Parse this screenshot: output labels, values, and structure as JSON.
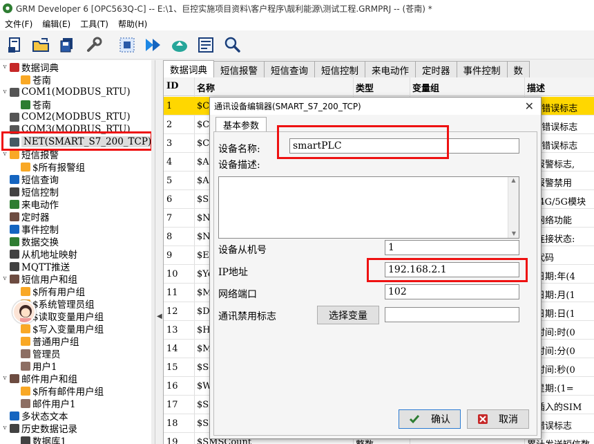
{
  "window": {
    "title": "GRM Developer 6 [OPC563Q-C]  -- E:\\1、巨控实施项目资料\\客户程序\\靓利能源\\测试工程.GRMPRJ -- (苍南) *"
  },
  "menu": [
    "文件(F)",
    "编辑(E)",
    "工具(T)",
    "帮助(H)"
  ],
  "toolbar": {
    "icons": [
      "new-file-icon",
      "open-folder-icon",
      "save-icon",
      "wrench-icon",
      "grid-icon",
      "forward-icon",
      "upload-icon",
      "settings-panel-icon",
      "magnifier-icon"
    ]
  },
  "tree": [
    {
      "label": "数据词典",
      "icon": "dictionary-icon",
      "indent": 1,
      "expander": "v",
      "color": "#c62828"
    },
    {
      "label": "苍南",
      "icon": "folder-icon",
      "indent": 2,
      "expander": "",
      "color": "#f9a825"
    },
    {
      "label": "COM1(MODBUS_RTU)",
      "icon": "serial-port-icon",
      "indent": 1,
      "expander": "v",
      "color": "#555"
    },
    {
      "label": "苍南",
      "icon": "device-icon",
      "indent": 2,
      "expander": "",
      "color": "#2e7d32"
    },
    {
      "label": "COM2(MODBUS_RTU)",
      "icon": "serial-port-icon",
      "indent": 1,
      "expander": "",
      "color": "#555"
    },
    {
      "label": "COM3(MODBUS_RTU)",
      "icon": "serial-port-icon",
      "indent": 1,
      "expander": "",
      "color": "#555"
    },
    {
      "label": "NET(SMART_S7_200_TCP)",
      "icon": "network-icon",
      "indent": 1,
      "expander": "",
      "color": "#455a64",
      "selected": true
    },
    {
      "label": "短信报警",
      "icon": "bell-icon",
      "indent": 1,
      "expander": "v",
      "color": "#f9a825"
    },
    {
      "label": "$所有报警组",
      "icon": "folder-icon",
      "indent": 2,
      "expander": "",
      "color": "#f9a825"
    },
    {
      "label": "短信查询",
      "icon": "sms-query-icon",
      "indent": 1,
      "expander": "",
      "color": "#1565c0"
    },
    {
      "label": "短信控制",
      "icon": "sms-control-icon",
      "indent": 1,
      "expander": "",
      "color": "#424242"
    },
    {
      "label": "来电动作",
      "icon": "phone-icon",
      "indent": 1,
      "expander": "",
      "color": "#2e7d32"
    },
    {
      "label": "定时器",
      "icon": "clock-icon",
      "indent": 1,
      "expander": "",
      "color": "#6d4c41"
    },
    {
      "label": "事件控制",
      "icon": "event-icon",
      "indent": 1,
      "expander": "",
      "color": "#1565c0"
    },
    {
      "label": "数据交换",
      "icon": "exchange-icon",
      "indent": 1,
      "expander": "",
      "color": "#2e7d32"
    },
    {
      "label": "从机地址映射",
      "icon": "address-map-icon",
      "indent": 1,
      "expander": "",
      "color": "#424242"
    },
    {
      "label": "MQTT推送",
      "icon": "mqtt-icon",
      "indent": 1,
      "expander": "",
      "color": "#424242"
    },
    {
      "label": "短信用户和组",
      "icon": "users-icon",
      "indent": 1,
      "expander": "v",
      "color": "#6d4c41"
    },
    {
      "label": "$所有用户组",
      "icon": "folder-icon",
      "indent": 2,
      "expander": "",
      "color": "#f9a825"
    },
    {
      "label": "$系统管理员组",
      "icon": "folder-icon",
      "indent": 2,
      "expander": "",
      "color": "#f9a825"
    },
    {
      "label": "$读取变量用户组",
      "icon": "folder-icon",
      "indent": 2,
      "expander": "",
      "color": "#f9a825"
    },
    {
      "label": "$写入变量用户组",
      "icon": "folder-icon",
      "indent": 2,
      "expander": "",
      "color": "#f9a825"
    },
    {
      "label": "普通用户组",
      "icon": "folder-icon",
      "indent": 2,
      "expander": "",
      "color": "#f9a825"
    },
    {
      "label": "管理员",
      "icon": "user-icon",
      "indent": 2,
      "expander": "",
      "color": "#8d6e63"
    },
    {
      "label": "用户1",
      "icon": "user-icon",
      "indent": 2,
      "expander": "",
      "color": "#8d6e63"
    },
    {
      "label": "邮件用户和组",
      "icon": "mail-users-icon",
      "indent": 1,
      "expander": "v",
      "color": "#6d4c41"
    },
    {
      "label": "$所有邮件用户组",
      "icon": "folder-icon",
      "indent": 2,
      "expander": "",
      "color": "#f9a825"
    },
    {
      "label": "邮件用户1",
      "icon": "user-icon",
      "indent": 2,
      "expander": "",
      "color": "#8d6e63"
    },
    {
      "label": "多状态文本",
      "icon": "text-icon",
      "indent": 1,
      "expander": "",
      "color": "#1565c0"
    },
    {
      "label": "历史数据记录",
      "icon": "history-icon",
      "indent": 1,
      "expander": "v",
      "color": "#424242"
    },
    {
      "label": "数据库1",
      "icon": "database-icon",
      "indent": 2,
      "expander": "",
      "color": "#424242"
    }
  ],
  "tabs": [
    "数据词典",
    "短信报警",
    "短信查询",
    "短信控制",
    "来电动作",
    "定时器",
    "事件控制",
    "数"
  ],
  "grid": {
    "headers": [
      "ID",
      "名称",
      "类型",
      "变量组",
      "描述"
    ],
    "rows": [
      {
        "id": "1",
        "name": "$Co",
        "type": "",
        "group": "",
        "desc": "口1错误标志"
      },
      {
        "id": "2",
        "name": "$Co",
        "type": "",
        "group": "",
        "desc": "口2错误标志"
      },
      {
        "id": "3",
        "name": "$Co",
        "type": "",
        "group": "",
        "desc": "口3错误标志"
      },
      {
        "id": "4",
        "name": "$AL",
        "type": "",
        "group": "",
        "desc": "局报警标志,"
      },
      {
        "id": "5",
        "name": "$AL",
        "type": "",
        "group": "",
        "desc": "局报警禁用"
      },
      {
        "id": "6",
        "name": "$SI",
        "type": "",
        "group": "",
        "desc": "信/4G/5G模块"
      },
      {
        "id": "7",
        "name": "$NE",
        "type": "",
        "group": "",
        "desc": "用网络功能"
      },
      {
        "id": "8",
        "name": "$Ne",
        "type": "",
        "group": "",
        "desc": "络连接状态:"
      },
      {
        "id": "9",
        "name": "$Er",
        "type": "",
        "group": "",
        "desc": "误代码"
      },
      {
        "id": "10",
        "name": "$Ye",
        "type": "",
        "group": "",
        "desc": "前日期:年(4"
      },
      {
        "id": "11",
        "name": "$Mo",
        "type": "",
        "group": "",
        "desc": "前日期:月(1"
      },
      {
        "id": "12",
        "name": "$Da",
        "type": "",
        "group": "",
        "desc": "前日期:日(1"
      },
      {
        "id": "13",
        "name": "$Ho",
        "type": "",
        "group": "",
        "desc": "前时间:时(0"
      },
      {
        "id": "14",
        "name": "$Mi",
        "type": "",
        "group": "",
        "desc": "前时间:分(0"
      },
      {
        "id": "15",
        "name": "$Se",
        "type": "",
        "group": "",
        "desc": "前时间:秒(0"
      },
      {
        "id": "16",
        "name": "$We",
        "type": "",
        "group": "",
        "desc": "前星期:(1="
      },
      {
        "id": "17",
        "name": "$SI",
        "type": "",
        "group": "",
        "desc": "前插入的SIM"
      },
      {
        "id": "18",
        "name": "$SI",
        "type": "",
        "group": "",
        "desc": "卡错误标志"
      },
      {
        "id": "19",
        "name": "$SMSCount",
        "type": "整数",
        "group": "",
        "desc": "累计发送短信数"
      }
    ]
  },
  "dialog": {
    "title": "通讯设备编辑器(SMART_S7_200_TCP)",
    "tab": "基本参数",
    "device_name_label": "设备名称:",
    "device_name": "smartPLC",
    "device_desc_label": "设备描述:",
    "device_desc": "",
    "slave_id_label": "设备从机号",
    "slave_id": "1",
    "ip_label": "IP地址",
    "ip": "192.168.2.1",
    "port_label": "网络端口",
    "port": "102",
    "disable_flag_label": "通讯禁用标志",
    "select_var_button": "选择变量",
    "disable_flag_value": "",
    "ok_button": "确认",
    "cancel_button": "取消"
  },
  "colors": {
    "highlight_row": "#ffd700",
    "annotation_red": "#e11111",
    "ok_icon": "#2e7d32",
    "cancel_icon": "#c62828"
  }
}
